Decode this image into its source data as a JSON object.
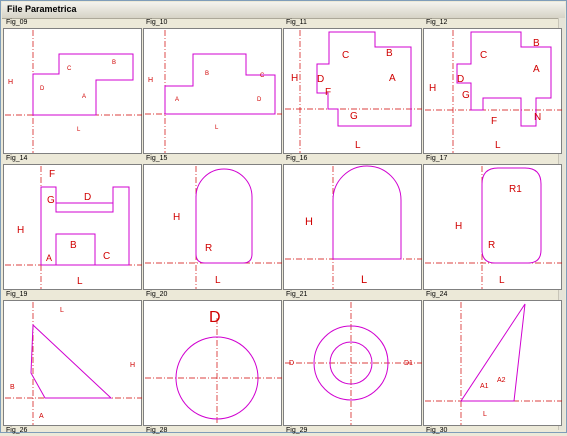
{
  "window": {
    "title": "File Parametrica"
  },
  "figures": [
    {
      "name": "Fig_09",
      "dims": [
        "H",
        "C",
        "B",
        "D",
        "A",
        "L"
      ]
    },
    {
      "name": "Fig_10",
      "dims": [
        "H",
        "B",
        "C",
        "A",
        "D",
        "L"
      ]
    },
    {
      "name": "Fig_11",
      "dims": [
        "C",
        "B",
        "H",
        "D",
        "A",
        "F",
        "G",
        "L"
      ]
    },
    {
      "name": "Fig_12",
      "dims": [
        "C",
        "B",
        "A",
        "H",
        "D",
        "G",
        "F",
        "N",
        "L"
      ]
    },
    {
      "name": "Fig_14",
      "dims": [
        "F",
        "G",
        "D",
        "H",
        "B",
        "A",
        "C",
        "L"
      ]
    },
    {
      "name": "Fig_15",
      "dims": [
        "H",
        "R",
        "L"
      ]
    },
    {
      "name": "Fig_16",
      "dims": [
        "H",
        "L"
      ]
    },
    {
      "name": "Fig_17",
      "dims": [
        "R1",
        "H",
        "R",
        "L"
      ]
    },
    {
      "name": "Fig_19",
      "dims": [
        "L",
        "H",
        "B",
        "A"
      ]
    },
    {
      "name": "Fig_20",
      "dims": [
        "D"
      ]
    },
    {
      "name": "Fig_21",
      "dims": [
        "D",
        "D1"
      ]
    },
    {
      "name": "Fig_24",
      "dims": [
        "A1",
        "A2",
        "L"
      ]
    }
  ],
  "footer_labels": [
    "Fig_26",
    "Fig_28",
    "Fig_29",
    "Fig_30"
  ],
  "colors": {
    "shape": "#d000d0",
    "axis": "#d00000",
    "dim": "#d00000",
    "panel": "#ffffff"
  }
}
